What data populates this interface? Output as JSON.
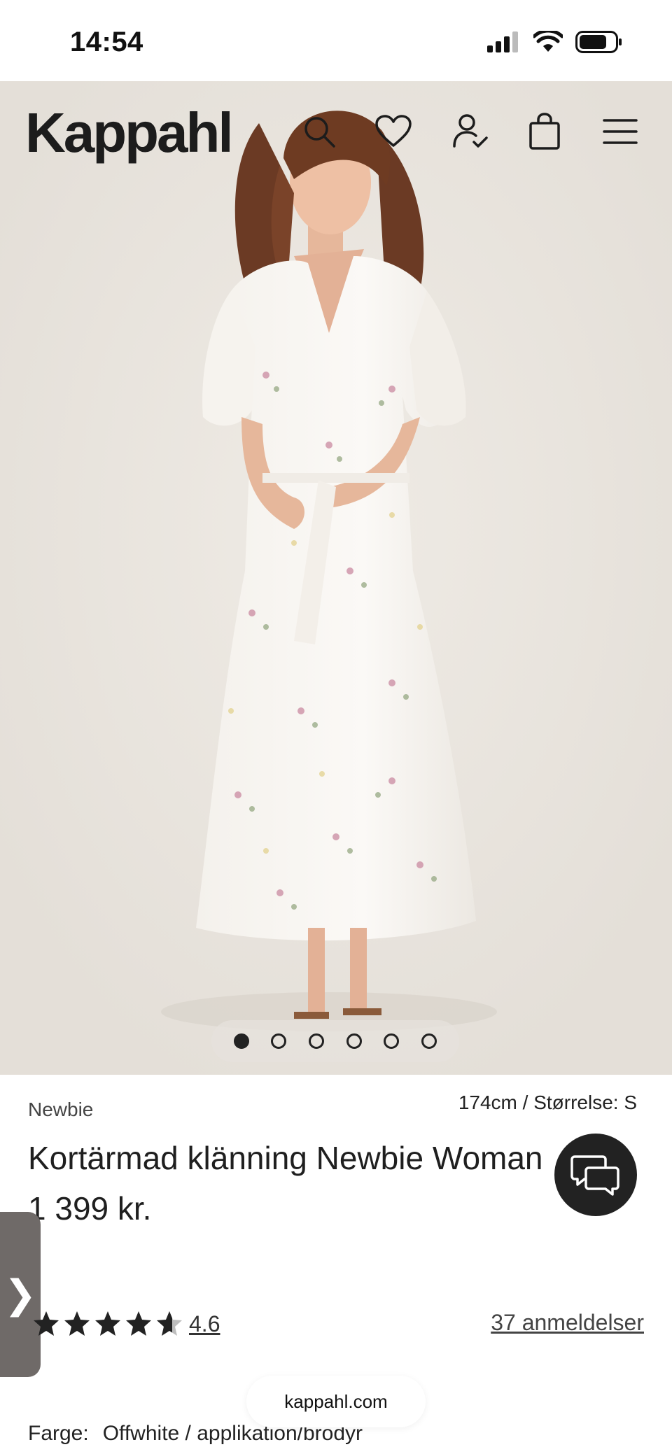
{
  "status_bar": {
    "time": "14:54",
    "icons": [
      "cellular-signal-icon",
      "wifi-icon",
      "battery-icon"
    ]
  },
  "header": {
    "logo": "Kappahl",
    "icons": [
      "search-icon",
      "heart-icon",
      "account-icon",
      "shopping-bag-icon",
      "menu-icon"
    ]
  },
  "carousel": {
    "total": 6,
    "active_index": 0
  },
  "product": {
    "brand": "Newbie",
    "model_info": "174cm /  Størrelse: S",
    "title": "Kortärmad klänning Newbie Woman",
    "price": "1 399 kr.",
    "rating": {
      "stars": 4.6,
      "max": 5,
      "value_text": "4.6"
    },
    "reviews_text": "37 anmeldelser",
    "color_label": "Farge:",
    "color_value": "Offwhite / applikation/brodyr"
  },
  "side_tab": {
    "glyph": "❯"
  },
  "browser": {
    "url": "kappahl.com"
  },
  "colors": {
    "text": "#1f1f1f",
    "chat_bg": "#222222",
    "side_tab_bg": "#6f6a68",
    "hero_bg": "#ebe7e1"
  }
}
